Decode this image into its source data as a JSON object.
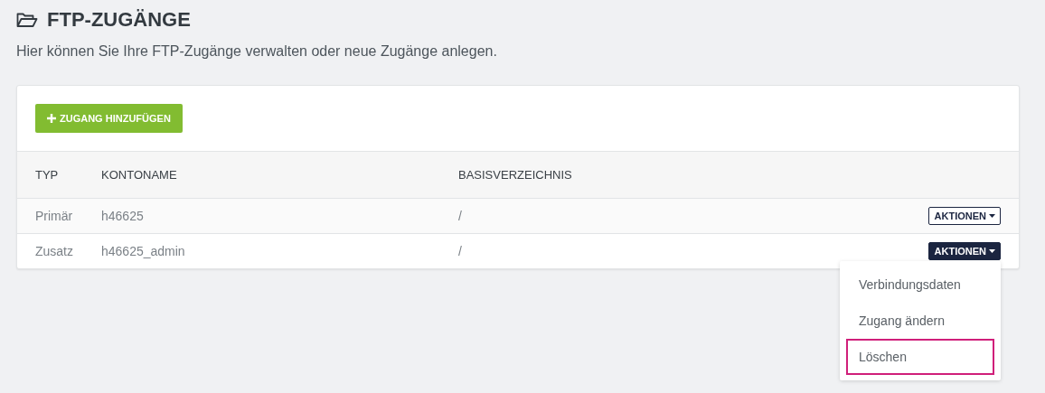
{
  "page": {
    "title": "FTP-ZUGÄNGE",
    "subtitle": "Hier können Sie Ihre FTP-Zugänge verwalten oder neue Zugänge anlegen."
  },
  "add_button": {
    "label": "ZUGANG HINZUFÜGEN"
  },
  "table": {
    "columns": [
      "TYP",
      "KONTONAME",
      "BASISVERZEICHNIS"
    ],
    "rows": [
      {
        "type": "Primär",
        "account": "h46625",
        "base_dir": "/",
        "action": "AKTIONEN",
        "open": false
      },
      {
        "type": "Zusatz",
        "account": "h46625_admin",
        "base_dir": "/",
        "action": "AKTIONEN",
        "open": true
      }
    ]
  },
  "menu": {
    "items": [
      {
        "label": "Verbindungsdaten",
        "selected": false
      },
      {
        "label": "Zugang ändern",
        "selected": false
      },
      {
        "label": "Löschen",
        "selected": true
      }
    ]
  }
}
